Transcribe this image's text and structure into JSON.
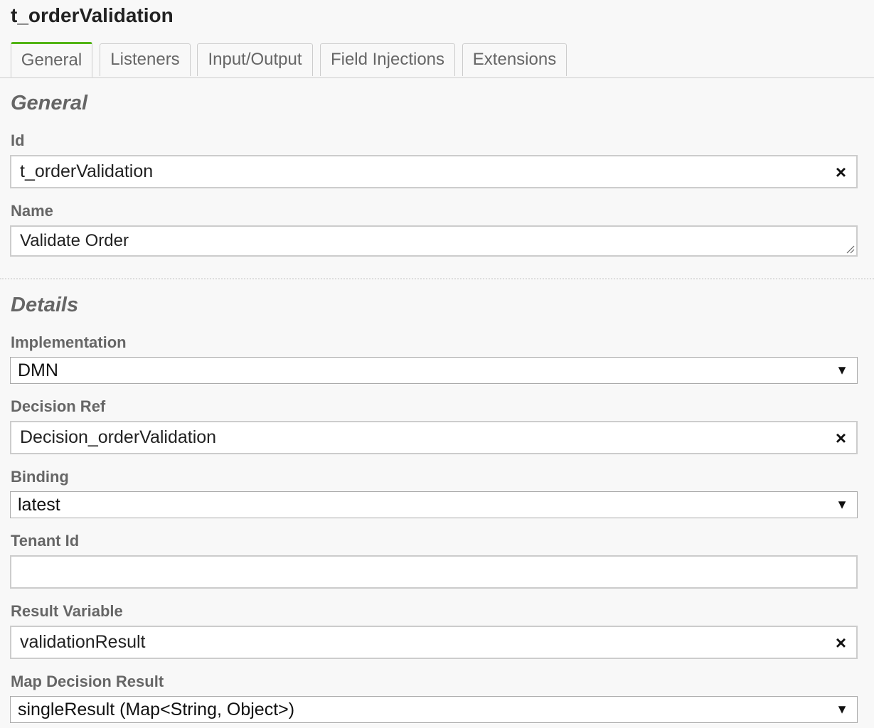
{
  "panel": {
    "title": "t_orderValidation"
  },
  "tabs": [
    {
      "label": "General"
    },
    {
      "label": "Listeners"
    },
    {
      "label": "Input/Output"
    },
    {
      "label": "Field Injections"
    },
    {
      "label": "Extensions"
    }
  ],
  "general": {
    "heading": "General",
    "id": {
      "label": "Id",
      "value": "t_orderValidation"
    },
    "name": {
      "label": "Name",
      "value": "Validate Order"
    }
  },
  "details": {
    "heading": "Details",
    "implementation": {
      "label": "Implementation",
      "value": "DMN"
    },
    "decision_ref": {
      "label": "Decision Ref",
      "value": "Decision_orderValidation"
    },
    "binding": {
      "label": "Binding",
      "value": "latest"
    },
    "tenant_id": {
      "label": "Tenant Id",
      "value": ""
    },
    "result_variable": {
      "label": "Result Variable",
      "value": "validationResult"
    },
    "map_decision_result": {
      "label": "Map Decision Result",
      "value": "singleResult (Map<String, Object>)"
    }
  },
  "icons": {
    "clear": "×",
    "dropdown_arrow": "▼"
  },
  "colors": {
    "active_tab_accent": "#52b415",
    "label": "#666666",
    "background": "#f8f8f8"
  }
}
